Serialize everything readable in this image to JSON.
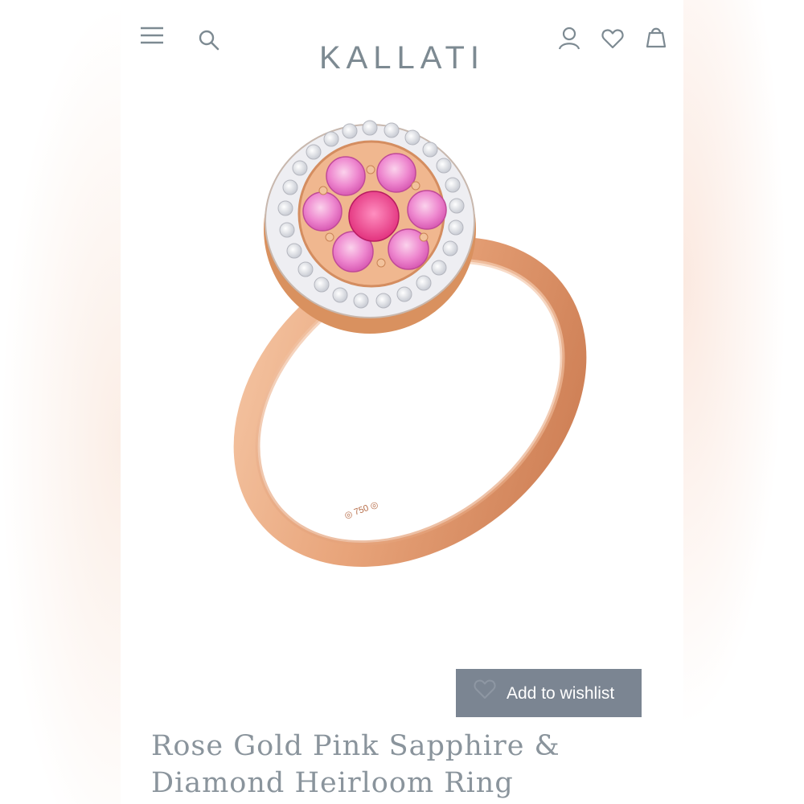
{
  "brand": {
    "name": "KALLATI",
    "color": "#7d8a92"
  },
  "header": {
    "icons": [
      "menu-icon",
      "search-icon",
      "account-icon",
      "heart-icon",
      "bag-icon"
    ]
  },
  "product": {
    "image": "rose-gold-ring-image",
    "title_line1": "Rose Gold Pink Sapphire &",
    "title_line2": "Diamond Heirloom Ring"
  },
  "actions": {
    "wishlist_label": "Add to wishlist",
    "wishlist_bg": "#7b8592"
  }
}
